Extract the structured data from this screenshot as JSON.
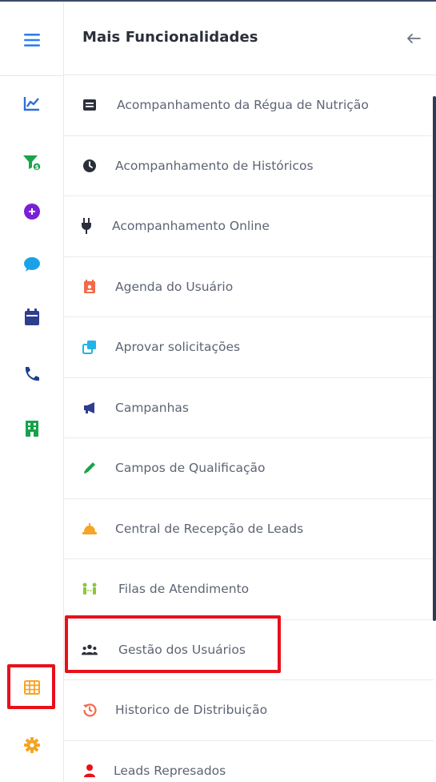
{
  "panel": {
    "title": "Mais Funcionalidades"
  },
  "rail": {
    "items": [
      {
        "icon": "menu-icon",
        "color": "#2f80ed"
      },
      {
        "icon": "chart-line-icon",
        "color": "#2f6fd8"
      },
      {
        "icon": "funnel-money-icon",
        "color": "#19a34a"
      },
      {
        "icon": "circle-plus-icon",
        "color": "#7b1fd6"
      },
      {
        "icon": "chat-bubble-icon",
        "color": "#1aa2e8"
      },
      {
        "icon": "calendar-icon",
        "color": "#2d3e8f"
      },
      {
        "icon": "phone-icon",
        "color": "#1f3f8f"
      },
      {
        "icon": "building-icon",
        "color": "#16a34a"
      },
      {
        "icon": "grid-icon",
        "color": "#f5a524"
      },
      {
        "icon": "gear-icon",
        "color": "#f5a524"
      }
    ]
  },
  "menu": {
    "items": [
      {
        "label": "Acompanhamento da Régua de Nutrição",
        "icon": "list-card-icon"
      },
      {
        "label": "Acompanhamento de Históricos",
        "icon": "clock-icon"
      },
      {
        "label": "Acompanhamento Online",
        "icon": "plug-icon"
      },
      {
        "label": "Agenda do Usuário",
        "icon": "calendar-user-icon"
      },
      {
        "label": "Aprovar solicitações",
        "icon": "copy-icon"
      },
      {
        "label": "Campanhas",
        "icon": "megaphone-icon"
      },
      {
        "label": "Campos de Qualificação",
        "icon": "pencil-icon"
      },
      {
        "label": "Central de Recepção de Leads",
        "icon": "bell-service-icon"
      },
      {
        "label": "Filas de Atendimento",
        "icon": "people-queue-icon"
      },
      {
        "label": "Gestão dos Usuários",
        "icon": "users-icon"
      },
      {
        "label": "Historico de Distribuição",
        "icon": "history-icon"
      },
      {
        "label": "Leads Represados",
        "icon": "user-icon"
      }
    ]
  },
  "colors": {
    "highlight": "#e8101a",
    "title": "#2b2f3a",
    "label": "#5d6473"
  }
}
